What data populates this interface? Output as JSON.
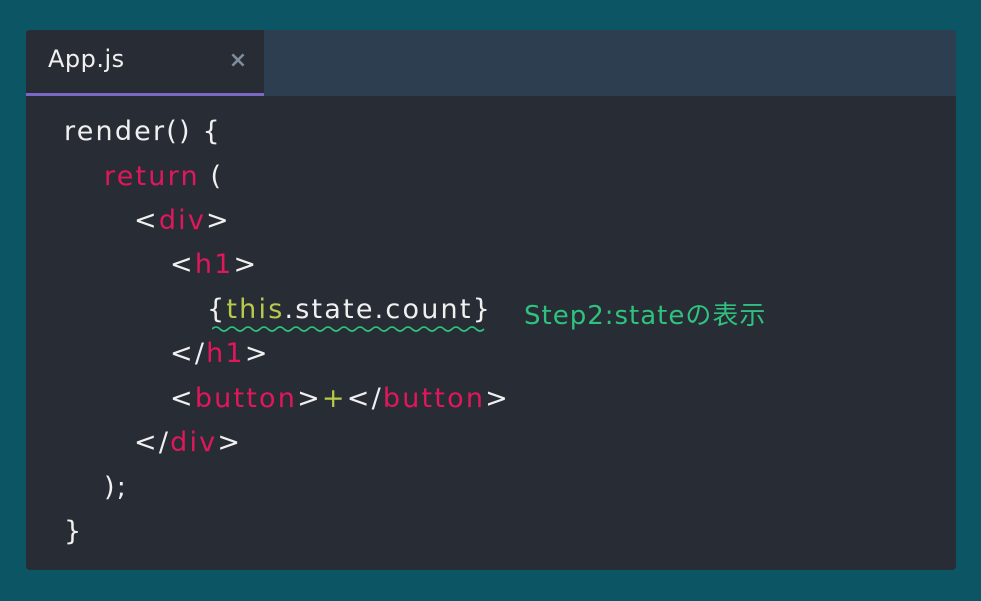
{
  "tab": {
    "title": "App.js",
    "close": "×"
  },
  "code": {
    "l1": {
      "a": "render() {"
    },
    "l2": {
      "kw": "return",
      "b": " ("
    },
    "l3": {
      "a": "<",
      "kw": "div",
      "b": ">"
    },
    "l4": {
      "a": "<",
      "kw": "h1",
      "b": ">"
    },
    "l5": {
      "a": "{",
      "th": "this",
      "b": ".state.count}"
    },
    "l6": {
      "a": "</",
      "kw": "h1",
      "b": ">"
    },
    "l7": {
      "a": "<",
      "kw1": "button",
      "b": ">",
      "plus": "+",
      "c": "</",
      "kw2": "button",
      "d": ">"
    },
    "l8": {
      "a": "</",
      "kw": "div",
      "b": ">"
    },
    "l9": {
      "a": ");"
    },
    "l10": {
      "a": "}"
    }
  },
  "annotation": {
    "text": "Step2:stateの表示",
    "color": "#2ec27e"
  }
}
